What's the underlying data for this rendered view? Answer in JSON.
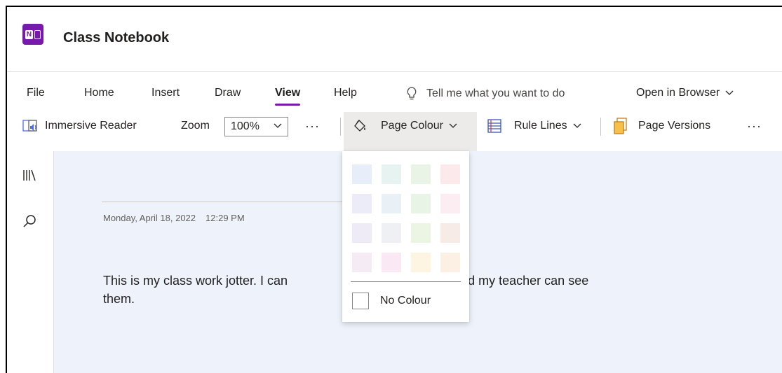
{
  "app": {
    "title": "Class Notebook",
    "logo_text": "N"
  },
  "tabs": [
    {
      "label": "File"
    },
    {
      "label": "Home"
    },
    {
      "label": "Insert"
    },
    {
      "label": "Draw"
    },
    {
      "label": "View"
    },
    {
      "label": "Help"
    }
  ],
  "tell_me": {
    "placeholder": "Tell me what you want to do"
  },
  "open_browser": {
    "label": "Open in Browser"
  },
  "toolbar": {
    "immersive_reader": "Immersive Reader",
    "zoom_label": "Zoom",
    "zoom_value": "100%",
    "more": "···",
    "page_colour": "Page Colour",
    "rule_lines": "Rule Lines",
    "page_versions": "Page Versions"
  },
  "page": {
    "date": "Monday, April 18, 2022",
    "time": "12:29 PM",
    "text_before": "This is my class work jotter. I can",
    "text_after": "rs here and my teacher can see",
    "text_line2": "them."
  },
  "page_colour_menu": {
    "no_colour_label": "No Colour",
    "swatches": [
      [
        "#e8eef9",
        "#e6f3f0",
        "#e9f4e7",
        "#fbe9ec"
      ],
      [
        "#ebecf7",
        "#e9f1f7",
        "#e8f4e6",
        "#fbedf1"
      ],
      [
        "#eeebf6",
        "#eef0f3",
        "#ecf4e4",
        "#f6ebe6"
      ],
      [
        "#f5ebf4",
        "#fae8f4",
        "#fdf5e2",
        "#fcf0e4"
      ]
    ]
  },
  "colors": {
    "accent": "#7719aa",
    "page_background": "#eef3fb"
  }
}
